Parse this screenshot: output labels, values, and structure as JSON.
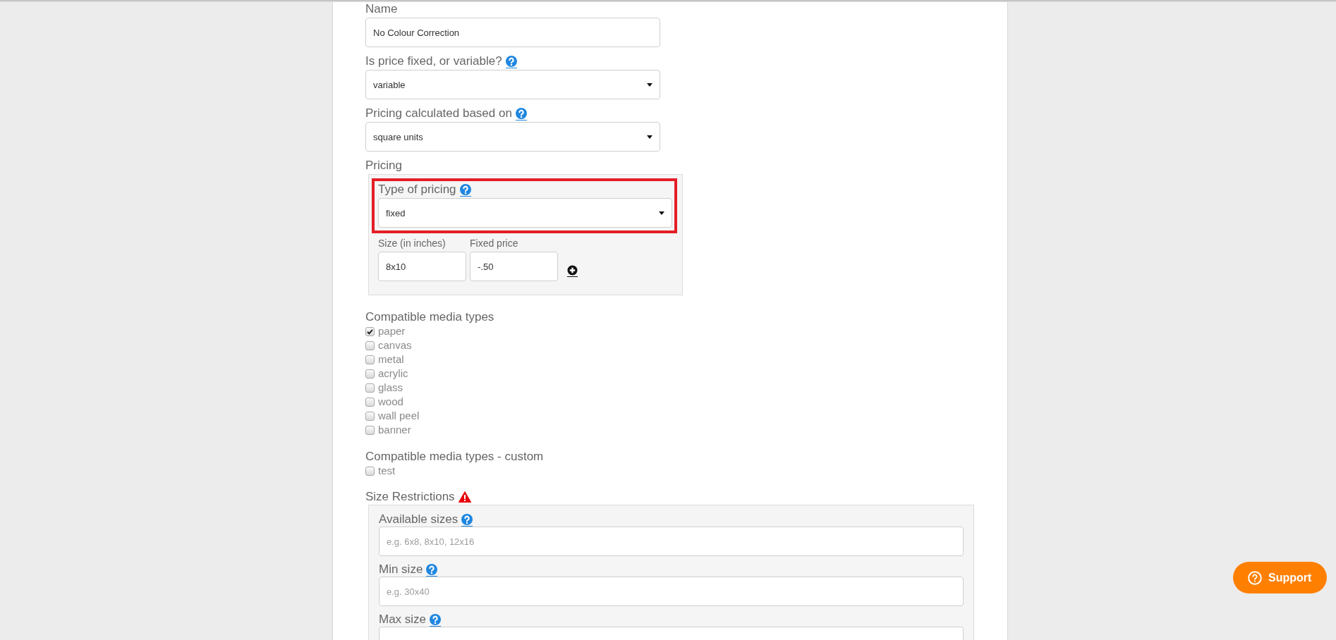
{
  "fields": [
    {
      "kind": "text",
      "label": "Name",
      "value": "No Colour Correction",
      "help": false
    },
    {
      "kind": "select",
      "label": "Is price fixed, or variable?",
      "value": "variable",
      "help": true
    },
    {
      "kind": "select",
      "label": "Pricing calculated based on",
      "value": "square units",
      "help": true
    }
  ],
  "pricing": {
    "label": "Pricing",
    "type_field": {
      "label": "Type of pricing",
      "value": "fixed",
      "help": true,
      "highlighted": true
    },
    "columns": [
      {
        "label": "Size (in inches)",
        "value": "8x10"
      },
      {
        "label": "Fixed price",
        "value": "-.50"
      }
    ]
  },
  "media_types": {
    "label": "Compatible media types",
    "items": [
      {
        "label": "paper",
        "checked": true
      },
      {
        "label": "canvas",
        "checked": false
      },
      {
        "label": "metal",
        "checked": false
      },
      {
        "label": "acrylic",
        "checked": false
      },
      {
        "label": "glass",
        "checked": false
      },
      {
        "label": "wood",
        "checked": false
      },
      {
        "label": "wall peel",
        "checked": false
      },
      {
        "label": "banner",
        "checked": false
      }
    ]
  },
  "custom_media_types": {
    "label": "Compatible media types - custom",
    "items": [
      {
        "label": "test",
        "checked": false
      }
    ]
  },
  "size_restrictions": {
    "label": "Size Restrictions",
    "warning": true,
    "fields": [
      {
        "label": "Available sizes",
        "placeholder": "e.g. 6x8, 8x10, 12x16",
        "help": true
      },
      {
        "label": "Min size",
        "placeholder": "e.g. 30x40",
        "help": true
      },
      {
        "label": "Max size",
        "help": true
      }
    ]
  },
  "support_button": {
    "label": "Support"
  }
}
